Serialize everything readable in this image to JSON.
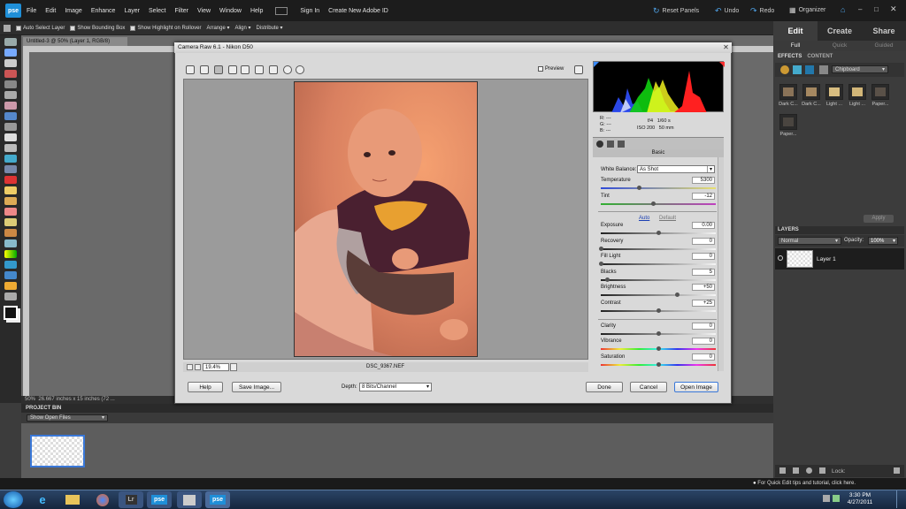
{
  "menubar": {
    "logo": "pse",
    "items": [
      "File",
      "Edit",
      "Image",
      "Enhance",
      "Layer",
      "Select",
      "Filter",
      "View",
      "Window",
      "Help"
    ],
    "signin": "Sign In",
    "create_id": "Create New Adobe ID",
    "reset": "Reset Panels",
    "undo": "Undo",
    "redo": "Redo",
    "organizer": "Organizer"
  },
  "options": {
    "auto_select": "Auto Select Layer",
    "bounding": "Show Bounding Box",
    "highlight": "Show Highlight on Rollover",
    "arrange": "Arrange",
    "align": "Align",
    "distribute": "Distribute"
  },
  "right_tabs": [
    "Edit",
    "Create",
    "Share"
  ],
  "right_subtabs": [
    "Full",
    "Quick",
    "Guided"
  ],
  "doc": {
    "tab": "Untitled-3 @ 50% (Layer 1, RGB/8)",
    "status": "50%",
    "status_size": "26.667 inches x 15 inches (72 ..."
  },
  "bin": {
    "header": "PROJECT BIN",
    "select": "Show Open Files"
  },
  "effects": {
    "tabs": [
      "EFFECTS",
      "CONTENT"
    ],
    "category": "Chipboard",
    "items": [
      "Dark C...",
      "Dark C...",
      "Light ...",
      "Light ...",
      "Paper...",
      "Paper..."
    ],
    "apply": "Apply"
  },
  "layers": {
    "header": "LAYERS",
    "blend": "Normal",
    "opacity_label": "Opacity:",
    "opacity": "100%",
    "layer": "Layer 1",
    "lock": "Lock:"
  },
  "tip": "For Quick Edit tips and tutorial, click here.",
  "clock": {
    "time": "3:30 PM",
    "date": "4/27/2011"
  },
  "taskbar": {
    "lr": "Lr",
    "pse": "pse"
  },
  "camera_raw": {
    "title": "Camera Raw 6.1  -  Nikon D50",
    "preview": "Preview",
    "zoom": "19.4%",
    "filename": "DSC_9367.NEF",
    "buttons": {
      "help": "Help",
      "save": "Save Image...",
      "done": "Done",
      "cancel": "Cancel",
      "open": "Open Image"
    },
    "depth_label": "Depth:",
    "depth": "8 Bits/Channel",
    "info": {
      "r": "R:",
      "g": "G:",
      "b": "B:",
      "dash": "---",
      "aperture": "f/4",
      "shutter": "1/60 s",
      "iso": "ISO 200",
      "focal": "50 mm"
    },
    "panel": "Basic",
    "wb_label": "White Balance:",
    "wb": "As Shot",
    "auto": "Auto",
    "default": "Default",
    "sliders": [
      {
        "label": "Temperature",
        "value": "5300",
        "pos": 0.33,
        "track": "temp"
      },
      {
        "label": "Tint",
        "value": "-12",
        "pos": 0.45,
        "track": "tint"
      },
      {
        "label": "Exposure",
        "value": "0.00",
        "pos": 0.5,
        "track": "gray"
      },
      {
        "label": "Recovery",
        "value": "0",
        "pos": 0.0,
        "track": "gray"
      },
      {
        "label": "Fill Light",
        "value": "0",
        "pos": 0.0,
        "track": "gray"
      },
      {
        "label": "Blacks",
        "value": "5",
        "pos": 0.05,
        "track": "gray"
      },
      {
        "label": "Brightness",
        "value": "+50",
        "pos": 0.66,
        "track": "gray"
      },
      {
        "label": "Contrast",
        "value": "+25",
        "pos": 0.5,
        "track": "gray"
      },
      {
        "label": "Clarity",
        "value": "0",
        "pos": 0.5,
        "track": "gray"
      },
      {
        "label": "Vibrance",
        "value": "0",
        "pos": 0.5,
        "track": "hue"
      },
      {
        "label": "Saturation",
        "value": "0",
        "pos": 0.5,
        "track": "hue"
      }
    ]
  }
}
